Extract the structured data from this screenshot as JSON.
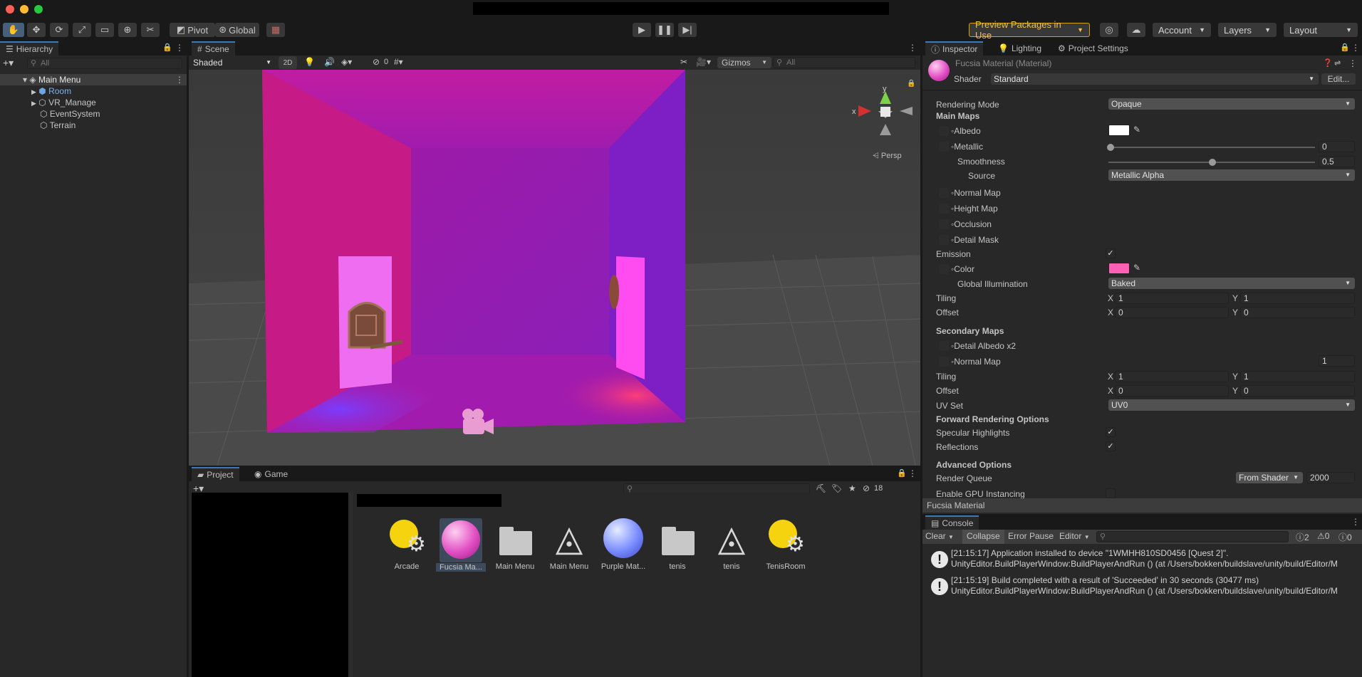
{
  "toolbar": {
    "pivot": "Pivot",
    "global": "Global",
    "preview_packages": "Preview Packages in Use",
    "account": "Account",
    "layers": "Layers",
    "layout": "Layout"
  },
  "hierarchy": {
    "tab": "Hierarchy",
    "search_placeholder": "All",
    "scene": "Main Menu",
    "items": [
      "Room",
      "VR_Manage",
      "EventSystem",
      "Terrain"
    ]
  },
  "scene_view": {
    "tab": "Scene",
    "shading": "Shaded",
    "mode_2d": "2D",
    "hidden_count": "0",
    "gizmos": "Gizmos",
    "search_placeholder": "All",
    "axis_y": "y",
    "axis_x": "x",
    "persp": "Persp"
  },
  "project": {
    "tab_project": "Project",
    "tab_game": "Game",
    "hidden_count": "18",
    "assets": [
      {
        "name": "Arcade",
        "icon": "lighting-settings-icon"
      },
      {
        "name": "Fucsia Ma...",
        "icon": "material-pink-icon"
      },
      {
        "name": "Main Menu",
        "icon": "folder-icon"
      },
      {
        "name": "Main Menu",
        "icon": "unity-scene-icon"
      },
      {
        "name": "Purple Mat...",
        "icon": "material-blue-icon"
      },
      {
        "name": "tenis",
        "icon": "folder-icon"
      },
      {
        "name": "tenis",
        "icon": "unity-scene-icon"
      },
      {
        "name": "TenisRoom",
        "icon": "lighting-settings-icon"
      }
    ]
  },
  "inspector": {
    "tabs": [
      "Inspector",
      "Lighting",
      "Project Settings"
    ],
    "material_name": "Fucsia Material (Material)",
    "shader_label": "Shader",
    "shader_value": "Standard",
    "edit": "Edit...",
    "rendering_mode_label": "Rendering Mode",
    "rendering_mode": "Opaque",
    "main_maps": "Main Maps",
    "albedo": "Albedo",
    "metallic": "Metallic",
    "metallic_value": "0",
    "smoothness": "Smoothness",
    "smoothness_value": "0.5",
    "source": "Source",
    "source_value": "Metallic Alpha",
    "normal_map": "Normal Map",
    "height_map": "Height Map",
    "occlusion": "Occlusion",
    "detail_mask": "Detail Mask",
    "emission": "Emission",
    "color": "Color",
    "global_illumination": "Global Illumination",
    "global_illumination_value": "Baked",
    "tiling": "Tiling",
    "offset": "Offset",
    "tiling_x": "1",
    "tiling_y": "1",
    "offset_x": "0",
    "offset_y": "0",
    "secondary_maps": "Secondary Maps",
    "detail_albedo": "Detail Albedo x2",
    "normal_map2": "Normal Map",
    "normal_map2_value": "1",
    "tiling2_x": "1",
    "tiling2_y": "1",
    "offset2_x": "0",
    "offset2_y": "0",
    "uv_set": "UV Set",
    "uv_set_value": "UV0",
    "forward_rendering": "Forward Rendering Options",
    "specular_highlights": "Specular Highlights",
    "reflections": "Reflections",
    "advanced_options": "Advanced Options",
    "render_queue": "Render Queue",
    "render_queue_mode": "From Shader",
    "render_queue_value": "2000",
    "gpu_instancing": "Enable GPU Instancing",
    "footer": "Fucsia Material",
    "x": "X",
    "y": "Y"
  },
  "console": {
    "tab": "Console",
    "clear": "Clear",
    "collapse": "Collapse",
    "error_pause": "Error Pause",
    "editor": "Editor",
    "count_info": "2",
    "count_warn": "0",
    "count_err": "0",
    "logs": [
      {
        "line1": "[21:15:17] Application installed to device \"1WMHH810SD0456 [Quest 2]\".",
        "line2": "UnityEditor.BuildPlayerWindow:BuildPlayerAndRun () (at /Users/bokken/buildslave/unity/build/Editor/M"
      },
      {
        "line1": "[21:15:19] Build completed with a result of 'Succeeded' in 30 seconds (30477 ms)",
        "line2": "UnityEditor.BuildPlayerWindow:BuildPlayerAndRun () (at /Users/bokken/buildslave/unity/build/Editor/M"
      }
    ]
  },
  "colors": {
    "accent": "#3a79bb",
    "room_pink": "#d11a8e",
    "room_purple": "#8a2be2",
    "emission": "#ff5fb4"
  }
}
